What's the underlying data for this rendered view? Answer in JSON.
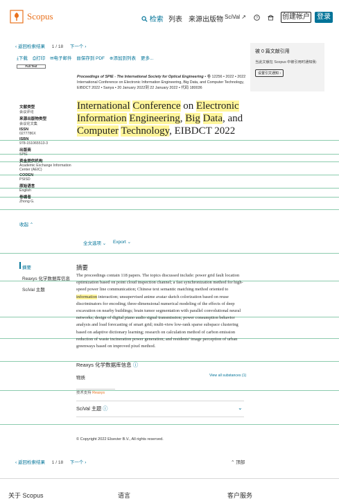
{
  "header": {
    "logo_text": "Scopus",
    "nav": [
      "检索",
      "列表",
      "来源出版物",
      "SciVal ↗"
    ],
    "help_icon": "help-circle-icon",
    "institution_icon": "institution-icon",
    "create_account": "创建帐户",
    "login": "登录"
  },
  "pager": {
    "back": "‹ 返回检索结果",
    "position": "1",
    "sep": "/",
    "total": "18",
    "next": "下一个 ›"
  },
  "actions": [
    "下载",
    "打印",
    "电子邮件",
    "保存到 PDF",
    "添加到列表",
    "更多..."
  ],
  "fulltext": "Full Text",
  "source_line": {
    "journal": "Proceedings of SPIE - The International Society for Optical Engineering",
    "rest": " • 卷 12256 • 2022 • 2022 International Conference on Electronic Information Engineering, Big Data, and Computer Technology, EIBDCT 2022 • Sanya • 20 January 2022到 22 January 2022 • 代码 180036"
  },
  "title_parts": [
    {
      "t": "International",
      "h": true
    },
    {
      "t": " ",
      "h": false
    },
    {
      "t": "Conference",
      "h": true
    },
    {
      "t": " on ",
      "h": false
    },
    {
      "t": "Electronic",
      "h": true
    },
    {
      "t": " ",
      "h": false
    },
    {
      "t": "Information",
      "h": true
    },
    {
      "t": " ",
      "h": false
    },
    {
      "t": "Engineering",
      "h": true
    },
    {
      "t": ", ",
      "h": false
    },
    {
      "t": "Big",
      "h": true
    },
    {
      "t": " ",
      "h": false
    },
    {
      "t": "Data",
      "h": true
    },
    {
      "t": ", and ",
      "h": false
    },
    {
      "t": "Computer",
      "h": true
    },
    {
      "t": " ",
      "h": false
    },
    {
      "t": "Technology",
      "h": true
    },
    {
      "t": ", EIBDCT 2022",
      "h": false
    }
  ],
  "metadata": [
    {
      "label": "文献类型",
      "value": "会议评论"
    },
    {
      "label": "来源出版物类型",
      "value": "会议论文集"
    },
    {
      "label": "ISSN",
      "value": "0277786X"
    },
    {
      "label": "ISBN",
      "value": "978-151065513-3"
    },
    {
      "label": "出版商",
      "value": "SPIE"
    },
    {
      "label": "资金提供机构",
      "value": "Academic Exchange Information Center (AEIC)"
    },
    {
      "label": "CODEN",
      "value": "PSISD"
    },
    {
      "label": "原始语言",
      "value": "English"
    },
    {
      "label": "卷编者",
      "value": "Zhong G."
    }
  ],
  "collapse": "收起 ⌃",
  "sidebar_box": {
    "heading": "被 0 篇文献引用",
    "text": "当此文献在 Scopus 中被引用时通知我:",
    "button": "设置引文通知 ›"
  },
  "options": {
    "full": "全文选项 ⌄",
    "export": "Export ⌄"
  },
  "left_nav": [
    "摘要",
    "Reaxys 化学数据库信息",
    "SciVal 主题"
  ],
  "abstract": {
    "heading": "摘要",
    "before": "The proceedings contain 118 papers. The topics discussed include: power grid fault location optimization based on point cloud inspection channel; a fast synchronization method for high-speed power line communication; Chinese text semantic matching method oriented to ",
    "highlight": "information",
    "after": " interaction; unsupervised anime avatar sketch colorization based on reuse discriminators for encoding; three-dimensional numerical modeling of the effects of deep excavation on nearby buildings; brain tumor segmentation with parallel convolutional neural networks; design of digital piano audio signal transmission; power consumption behavior analysis and load forecasting of smart grid; multi-view low-rank sparse subspace clustering based on adaptive dictionary learning; research on calculation method of carbon emission reduction of waste incineration power generation; and residents' image perception of urban greenways based on improved pixel method."
  },
  "reaxys": {
    "heading": "Reaxys 化学数据库信息",
    "substances": "物质",
    "view_all": "View all substances (1)",
    "powered": "技术支持",
    "brand": "Reaxys"
  },
  "scival": {
    "heading": "SciVal 主题"
  },
  "copyright": "© Copyright 2022 Elsevier B.V., All rights reserved.",
  "bottom_pager": {
    "back": "‹ 返回检索结果",
    "position": "1",
    "sep": "/",
    "total": "18",
    "next": "下一个 ›",
    "top": "顶部"
  },
  "footer": [
    "关于 Scopus",
    "语言",
    "客户服务"
  ],
  "colors": {
    "brand_orange": "#e9711c",
    "link": "#007398",
    "highlight": "#fff59a"
  }
}
